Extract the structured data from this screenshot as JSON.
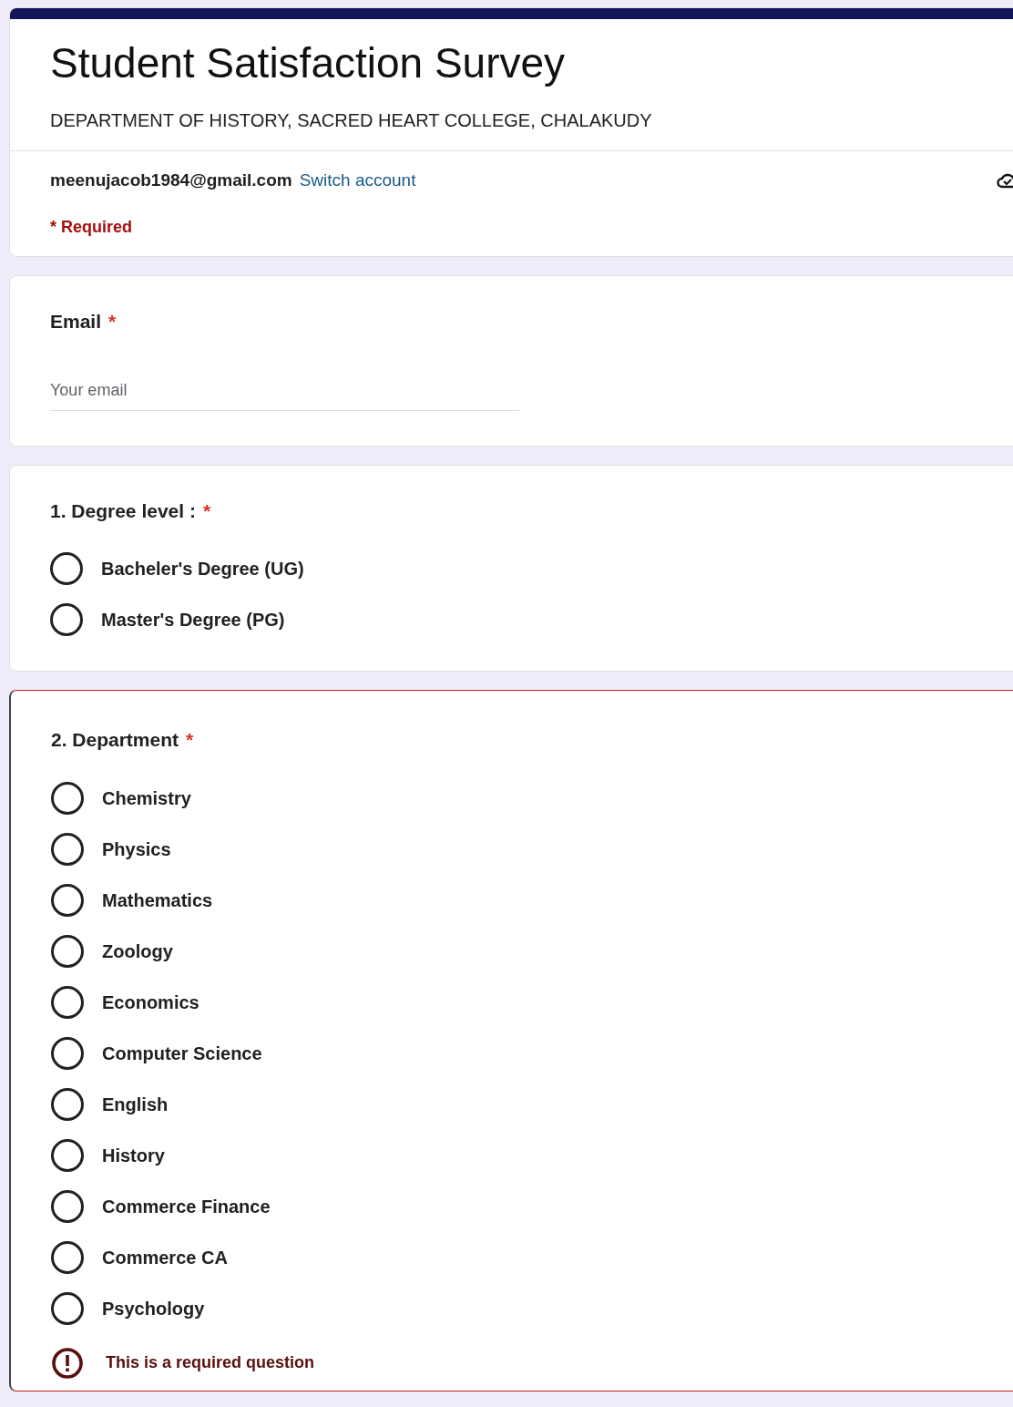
{
  "form": {
    "title": "Student Satisfaction Survey",
    "subtitle": "DEPARTMENT OF HISTORY, SACRED HEART COLLEGE, CHALAKUDY"
  },
  "account": {
    "email": "meenujacob1984@gmail.com",
    "switch_link": "Switch account"
  },
  "required_note": "* Required",
  "questions": [
    {
      "kind": "text",
      "label": "Email",
      "required_mark": "*",
      "placeholder": "Your email"
    },
    {
      "kind": "radio",
      "label": "1. Degree level :",
      "required_mark": "*",
      "options": [
        {
          "label": "Bacheler's Degree (UG)",
          "selected": false
        },
        {
          "label": "Master's Degree (PG)",
          "selected": false
        }
      ]
    },
    {
      "kind": "radio",
      "label": "2. Department",
      "required_mark": "*",
      "error": "This is a required question",
      "options": [
        {
          "label": "Chemistry",
          "selected": false
        },
        {
          "label": "Physics",
          "selected": false
        },
        {
          "label": "Mathematics",
          "selected": false
        },
        {
          "label": "Zoology",
          "selected": false
        },
        {
          "label": "Economics",
          "selected": false
        },
        {
          "label": "Computer Science",
          "selected": false
        },
        {
          "label": "English",
          "selected": false
        },
        {
          "label": "History",
          "selected": false
        },
        {
          "label": "Commerce Finance",
          "selected": false
        },
        {
          "label": "Commerce CA",
          "selected": false
        },
        {
          "label": "Psychology",
          "selected": false
        }
      ]
    }
  ]
}
